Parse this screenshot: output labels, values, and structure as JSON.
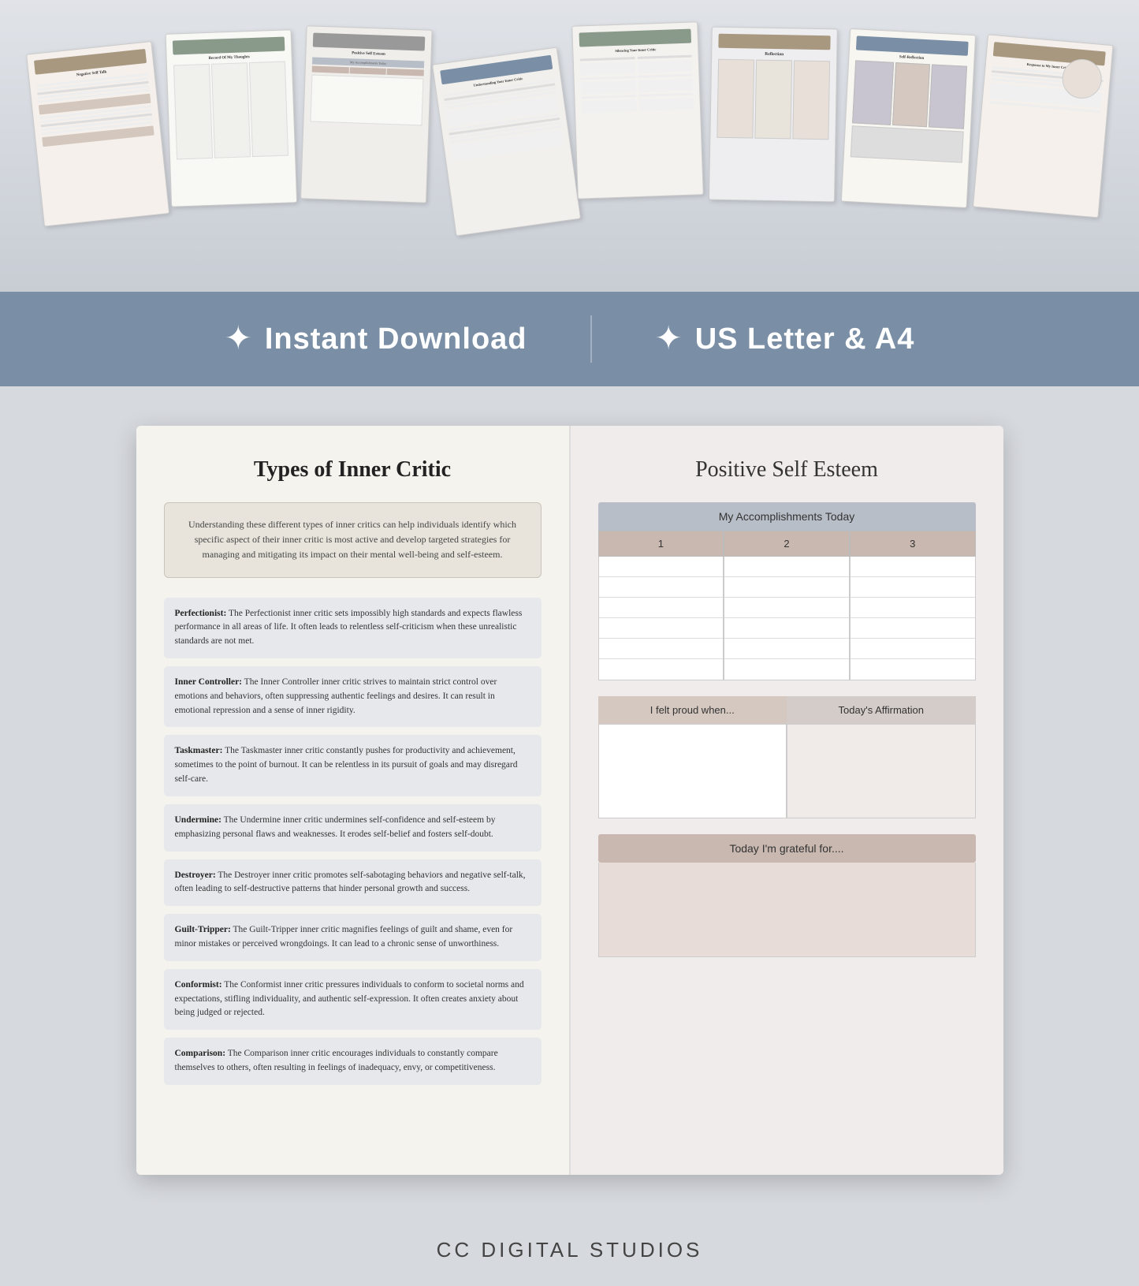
{
  "collage": {
    "pages": [
      {
        "id": "negative-self-talk",
        "title": "Negative Self Talk",
        "bg": "#f5f0eb",
        "header_color": "#a89880",
        "rotation": -6
      },
      {
        "id": "record-thoughts",
        "title": "Record Of My Thoughts",
        "bg": "#f8f8f4",
        "header_color": "#8a9a8a",
        "rotation": -2
      },
      {
        "id": "positive-self",
        "title": "Positive Self Esteem",
        "bg": "#f0eeeb",
        "header_color": "#b8b0a8",
        "rotation": 2
      },
      {
        "id": "understanding-critic",
        "title": "Understanding Your Inner Critic",
        "bg": "#f5f3ee",
        "header_color": "#7a8fa6",
        "rotation": -8
      },
      {
        "id": "silencing-critic",
        "title": "Silencing Your Inner Critic",
        "bg": "#f2f0ec",
        "header_color": "#8a9a8a",
        "rotation": -2
      },
      {
        "id": "reflection",
        "title": "Reflection",
        "bg": "#f4f2ee",
        "header_color": "#9a8878",
        "rotation": 1
      },
      {
        "id": "self-reflection",
        "title": "Self-Reflection",
        "bg": "#eeedf0",
        "header_color": "#7a8fa6",
        "rotation": 3
      },
      {
        "id": "response-critic",
        "title": "Response to My Inner Critic",
        "bg": "#f8f6f0",
        "header_color": "#a89880",
        "rotation": 5
      }
    ]
  },
  "banner": {
    "item1": "Instant Download",
    "item2": "US Letter & A4",
    "star_char": "✦"
  },
  "left_page": {
    "title": "Types of Inner Critic",
    "intro": "Understanding these different types of inner critics can help individuals identify which specific aspect of their inner critic is most active and develop targeted strategies for managing and mitigating its impact on their mental well-being and self-esteem.",
    "critics": [
      {
        "name": "Perfectionist:",
        "description": "The Perfectionist inner critic sets impossibly high standards and expects flawless performance in all areas of life. It often leads to relentless self-criticism when these unrealistic standards are not met."
      },
      {
        "name": "Inner Controller:",
        "description": "The Inner Controller inner critic strives to maintain strict control over emotions and behaviors, often suppressing authentic feelings and desires. It can result in emotional repression and a sense of inner rigidity."
      },
      {
        "name": "Taskmaster:",
        "description": "The Taskmaster inner critic constantly pushes for productivity and achievement, sometimes to the point of burnout. It can be relentless in its pursuit of goals and may disregard self-care."
      },
      {
        "name": "Undermine:",
        "description": "The Undermine inner critic undermines self-confidence and self-esteem by emphasizing personal flaws and weaknesses. It erodes self-belief and fosters self-doubt."
      },
      {
        "name": "Destroyer:",
        "description": "The Destroyer inner critic promotes self-sabotaging behaviors and negative self-talk, often leading to self-destructive patterns that hinder personal growth and success."
      },
      {
        "name": "Guilt-Tripper:",
        "description": "The Guilt-Tripper inner critic magnifies feelings of guilt and shame, even for minor mistakes or perceived wrongdoings. It can lead to a chronic sense of unworthiness."
      },
      {
        "name": "Conformist:",
        "description": "The Conformist inner critic pressures individuals to conform to societal norms and expectations, stifling individuality, and authentic self-expression. It often creates anxiety about being judged or rejected."
      },
      {
        "name": "Comparison:",
        "description": "The Comparison inner critic encourages individuals to constantly compare themselves to others, often resulting in feelings of inadequacy, envy, or competitiveness."
      }
    ]
  },
  "right_page": {
    "title": "Positive Self Esteem",
    "accomplishments_header": "My Accomplishments Today",
    "col1": "1",
    "col2": "2",
    "col3": "3",
    "rows_count": 6,
    "proud_label": "I felt proud when...",
    "affirmation_label": "Today's Affirmation",
    "grateful_label": "Today I'm grateful for...."
  },
  "footer": {
    "brand": "CC DIGITAL STUDIOS"
  }
}
